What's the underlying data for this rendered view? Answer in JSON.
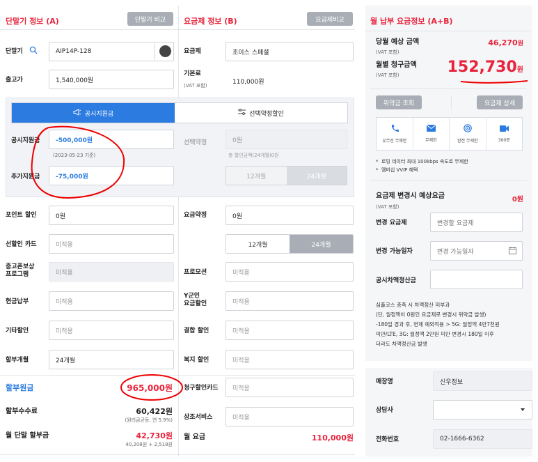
{
  "device_section": {
    "title": "단말기 정보 (A)",
    "compare_button": "단말기 비교",
    "device_label": "단말기",
    "device_value": "AIP14P-128",
    "price_label": "출고가",
    "price_value": "1,540,000원"
  },
  "plan_section": {
    "title": "요금제 정보 (B)",
    "compare_button": "요금제비교",
    "plan_label": "요금제",
    "plan_value": "초이스 스페셜",
    "base_fee_label": "기본료",
    "base_fee_sub": "(VAT 포함)",
    "base_fee_value": "110,000원"
  },
  "discount_tabs": {
    "tab1": "공시지원금",
    "tab2": "선택약정할인"
  },
  "support": {
    "public_label": "공시지원금",
    "public_value": "-500,000원",
    "public_date": "(2023-05-23 기준)",
    "extra_label": "추가지원금",
    "extra_value": "-75,000원",
    "contract_label": "선택약정",
    "contract_value": "0원",
    "contract_note": "총 할인금액(24개월)0원",
    "seg_12": "12개월",
    "seg_24": "24개월"
  },
  "left_rows": {
    "point_label": "포인트 할인",
    "point_value": "0원",
    "prepaid_label": "선할인 카드",
    "prepaid_value": "미적용",
    "used_label": "중고폰보상\n프로그램",
    "used_value": "미적용",
    "cash_label": "현금납부",
    "cash_value": "미적용",
    "other_label": "기타할인",
    "other_value": "미적용",
    "months_label": "할부개월",
    "months_value": "24개월",
    "principal_label": "할부원금",
    "principal_value": "965,000원",
    "fee_label": "할부수수료",
    "fee_value": "60,422원",
    "fee_note": "(원리금균등, 연 5.9%)",
    "monthly_label": "월 단말 할부금",
    "monthly_value": "42,730원",
    "monthly_note": "40,208원 + 2,518원"
  },
  "mid_rows": {
    "plan_contract_label": "요금약정",
    "plan_contract_value": "0원",
    "seg_12": "12개월",
    "seg_24": "24개월",
    "promo_label": "프로모션",
    "promo_value": "미적용",
    "ygen_label": "Y군인\n요금할인",
    "ygen_value": "미적용",
    "bundle_label": "결합 할인",
    "bundle_value": "미적용",
    "welfare_label": "복지 할인",
    "welfare_value": "미적용",
    "billcard_label": "청구할인카드",
    "billcard_value": "미적용",
    "addon_label": "상조서비스",
    "addon_value": "미적용",
    "monthly_fee_label": "월 요금",
    "monthly_fee_value": "110,000원"
  },
  "payment": {
    "title": "월 납부 요금정보 (A+B)",
    "month_label": "당월 예상 금액",
    "month_sub": "(VAT 포함)",
    "month_value": "46,270",
    "month_unit": "원",
    "bill_label": "월별 청구금액",
    "bill_sub": "(VAT 포함)",
    "bill_value": "152,730",
    "bill_unit": "원",
    "penalty_button": "위약금 조회",
    "detail_button": "요금제 상세",
    "features": [
      {
        "icon": "phone-icon",
        "label": "유무선 무제한"
      },
      {
        "icon": "mail-icon",
        "label": "무제한"
      },
      {
        "icon": "wifi-icon",
        "label": "완전 무제한"
      },
      {
        "icon": "video-icon",
        "label": "300분"
      }
    ],
    "notes": [
      "로밍 데이터 최대 100kbps 속도로 무제한",
      "멤버십 VVIP 혜택"
    ]
  },
  "change": {
    "title": "요금제 변경시 예상요금",
    "sub": "(VAT 포함)",
    "value": "0원",
    "plan_label": "변경 요금제",
    "plan_placeholder": "변경할 요금제",
    "date_label": "변경 가능일자",
    "date_placeholder": "변경 가능일자",
    "settle_label": "공시차액정산금",
    "description": "심플코스 층족 시 차액정산 미부과\n(단, 월정액이 0원인 요금제로 변경시 위약금 발생)\n-180일 경과 후, 면제 예외적용 > 5G: 월정액 4만7천원\n미만/LTE, 3G: 월정액 2만원 미만 변경시 180일 이후\n더라도 차액정산금 발생"
  },
  "store": {
    "name_label": "매장명",
    "name_value": "신우정보",
    "agent_label": "상담사",
    "phone_label": "전화번호",
    "phone_value": "02-1666-6362"
  }
}
